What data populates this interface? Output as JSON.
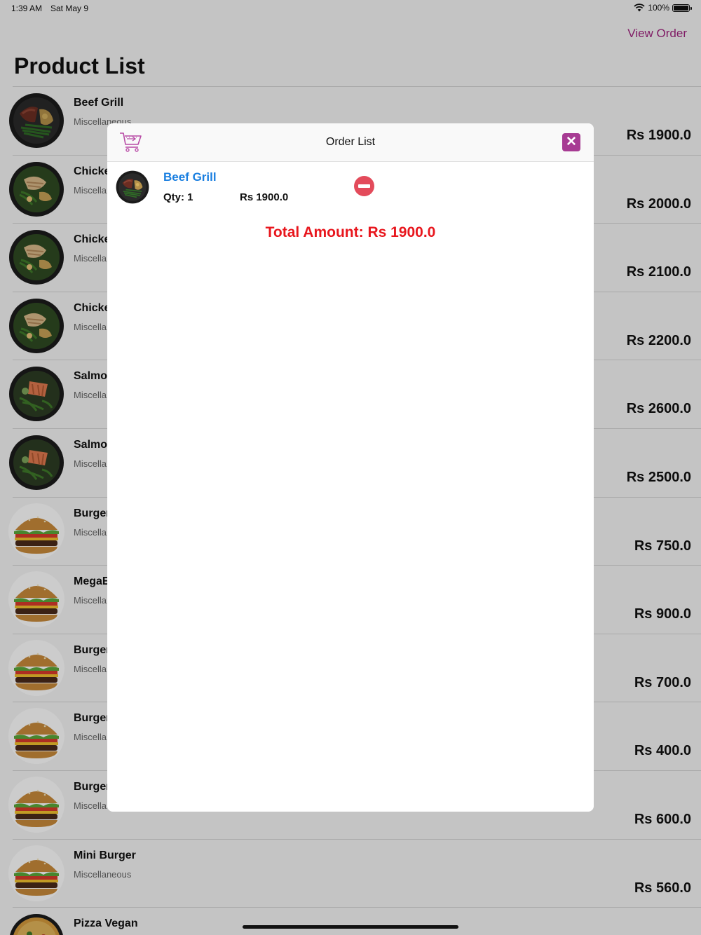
{
  "status_bar": {
    "time": "1:39 AM",
    "date": "Sat May 9",
    "battery": "100%",
    "battery_level": 1.0
  },
  "nav": {
    "view_order_label": "View Order",
    "title": "Product List"
  },
  "products": [
    {
      "name": "Beef Grill",
      "category": "Miscellaneous",
      "price": "Rs 1900.0",
      "image": "beef-bowl"
    },
    {
      "name": "Chicke",
      "category": "Miscella",
      "price": "Rs 2000.0",
      "image": "chicken-bowl"
    },
    {
      "name": "Chicke",
      "category": "Miscella",
      "price": "Rs 2100.0",
      "image": "chicken-bowl"
    },
    {
      "name": "Chicke",
      "category": "Miscella",
      "price": "Rs 2200.0",
      "image": "chicken-bowl"
    },
    {
      "name": "Salmo",
      "category": "Miscella",
      "price": "Rs 2600.0",
      "image": "salmon-bowl"
    },
    {
      "name": "Salmo",
      "category": "Miscella",
      "price": "Rs 2500.0",
      "image": "salmon-bowl"
    },
    {
      "name": "Burger",
      "category": "Miscella",
      "price": "Rs 750.0",
      "image": "burger"
    },
    {
      "name": "MegaE",
      "category": "Miscella",
      "price": "Rs 900.0",
      "image": "burger"
    },
    {
      "name": "Burger",
      "category": "Miscella",
      "price": "Rs 700.0",
      "image": "burger"
    },
    {
      "name": "Burger",
      "category": "Miscella",
      "price": "Rs 400.0",
      "image": "burger"
    },
    {
      "name": "Burger",
      "category": "Miscella",
      "price": "Rs 600.0",
      "image": "burger"
    },
    {
      "name": "Mini Burger",
      "category": "Miscellaneous",
      "price": "Rs 560.0",
      "image": "burger"
    },
    {
      "name": "Pizza Vegan",
      "category": "",
      "price": "",
      "image": "pizza"
    }
  ],
  "order_modal": {
    "title": "Order List",
    "close_icon": "close-icon",
    "cart_icon": "cart-icon",
    "items": [
      {
        "name": "Beef Grill",
        "qty": "Qty: 1",
        "price": "Rs 1900.0",
        "image": "beef-bowl"
      }
    ],
    "total": "Total Amount: Rs 1900.0"
  },
  "colors": {
    "accent": "#a0237f",
    "close_bg": "#a73b93",
    "item_link": "#1a7fe0",
    "total": "#e8161d",
    "remove": "#e34b5b"
  }
}
